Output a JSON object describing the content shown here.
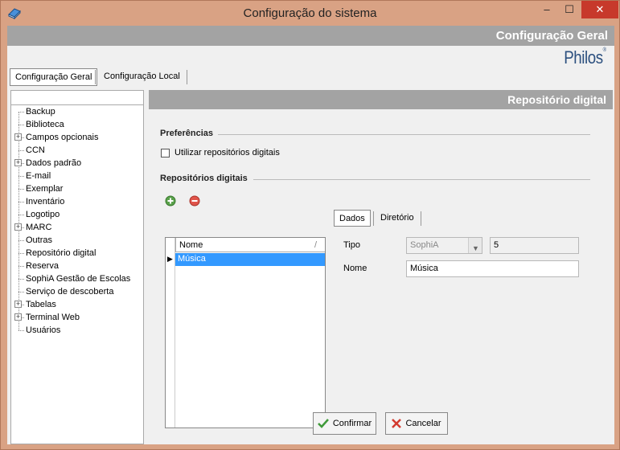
{
  "window": {
    "title": "Configuração do sistema",
    "min_glyph": "–",
    "max_glyph": "☐",
    "close_glyph": "✕"
  },
  "header": {
    "title": "Configuração Geral",
    "brand": "Philos",
    "brand_mark": "®"
  },
  "main_tabs": [
    {
      "label": "Configuração Geral",
      "active": true
    },
    {
      "label": "Configuração Local",
      "active": false
    }
  ],
  "tree": {
    "items": [
      {
        "label": "Backup",
        "expandable": false
      },
      {
        "label": "Biblioteca",
        "expandable": false
      },
      {
        "label": "Campos opcionais",
        "expandable": true
      },
      {
        "label": "CCN",
        "expandable": false
      },
      {
        "label": "Dados padrão",
        "expandable": true
      },
      {
        "label": "E-mail",
        "expandable": false
      },
      {
        "label": "Exemplar",
        "expandable": false
      },
      {
        "label": "Inventário",
        "expandable": false
      },
      {
        "label": "Logotipo",
        "expandable": false
      },
      {
        "label": "MARC",
        "expandable": true
      },
      {
        "label": "Outras",
        "expandable": false
      },
      {
        "label": "Repositório digital",
        "expandable": false
      },
      {
        "label": "Reserva",
        "expandable": false
      },
      {
        "label": "SophiA Gestão de Escolas",
        "expandable": false
      },
      {
        "label": "Serviço de descoberta",
        "expandable": false
      },
      {
        "label": "Tabelas",
        "expandable": true
      },
      {
        "label": "Terminal Web",
        "expandable": true
      },
      {
        "label": "Usuários",
        "expandable": false
      }
    ],
    "plus_glyph": "+"
  },
  "section": {
    "title": "Repositório digital",
    "preferences_label": "Preferências",
    "use_repos_label": "Utilizar repositórios digitais",
    "use_repos_checked": false,
    "repos_label": "Repositórios digitais"
  },
  "grid": {
    "column_header": "Nome",
    "sort_glyph": "/",
    "row_marker": "▶",
    "rows": [
      "Música"
    ]
  },
  "sub_tabs": [
    {
      "label": "Dados",
      "active": true
    },
    {
      "label": "Diretório",
      "active": false
    }
  ],
  "form": {
    "tipo_label": "Tipo",
    "tipo_value": "SophiA",
    "tipo_code": "5",
    "nome_label": "Nome",
    "nome_value": "Música",
    "arrow_glyph": "▼"
  },
  "buttons": {
    "confirm": "Confirmar",
    "cancel": "Cancelar"
  },
  "colors": {
    "title_bg": "#d9a284",
    "header_band": "#a3a3a3",
    "brand": "#2b4f7e",
    "selection": "#3399ff",
    "close_btn": "#c7392b"
  }
}
